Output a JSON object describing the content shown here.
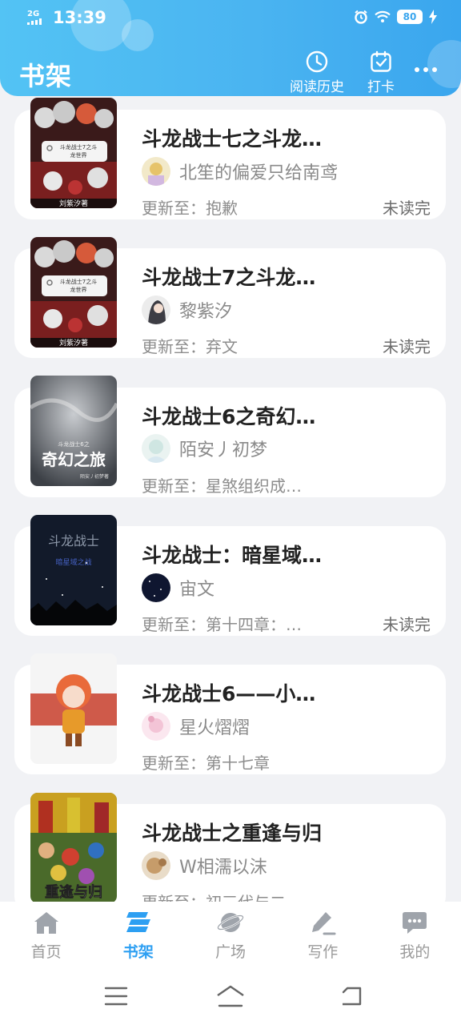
{
  "status_bar": {
    "network": "2G",
    "time": "13:39",
    "battery": "80"
  },
  "header": {
    "title": "书架",
    "history_label": "阅读历史",
    "checkin_label": "打卡"
  },
  "books": [
    {
      "title": "斗龙战士七之斗龙…",
      "author": "北笙的偏爱只给南鸢",
      "update": "更新至：抱歉",
      "status": "未读完",
      "cover_text": [
        "斗龙战士7之斗",
        "龙世界"
      ],
      "cover_author": "刘紫汐著"
    },
    {
      "title": "斗龙战士7之斗龙…",
      "author": "黎紫汐",
      "update": "更新至：弃文",
      "status": "未读完",
      "cover_text": [
        "斗龙战士7之斗",
        "龙世界"
      ],
      "cover_author": "刘紫汐著"
    },
    {
      "title": "斗龙战士6之奇幻…",
      "author": "陌安丿初梦",
      "update": "更新至：星煞组织成…",
      "status": "",
      "cover_text": [
        "斗龙战士6之",
        "奇幻之旅"
      ],
      "cover_author": "陌安丿初梦著"
    },
    {
      "title": "斗龙战士：暗星域…",
      "author": "宙文",
      "update": "更新至：第十四章：…",
      "status": "未读完",
      "cover_text": [
        "斗龙战士",
        "暗星域之战"
      ],
      "cover_author": ""
    },
    {
      "title": "斗龙战士6——小…",
      "author": "星火熠熠",
      "update": "更新至：第十七章",
      "status": "",
      "cover_text": [],
      "cover_author": ""
    },
    {
      "title": "斗龙战士之重逢与归",
      "author": "W相濡以沫",
      "update": "更新至：初三代与二…",
      "status": "",
      "cover_text": [
        "重逢与归"
      ],
      "cover_author": ""
    }
  ],
  "tabs": [
    {
      "label": "首页",
      "icon": "home-icon",
      "active": false
    },
    {
      "label": "书架",
      "icon": "bookshelf-icon",
      "active": true
    },
    {
      "label": "广场",
      "icon": "planet-icon",
      "active": false
    },
    {
      "label": "写作",
      "icon": "pen-icon",
      "active": false
    },
    {
      "label": "我的",
      "icon": "chat-bubble-icon",
      "active": false
    }
  ],
  "colors": {
    "accent": "#2d9ff2",
    "header_start": "#53c3f4",
    "header_end": "#3aa6ee"
  }
}
